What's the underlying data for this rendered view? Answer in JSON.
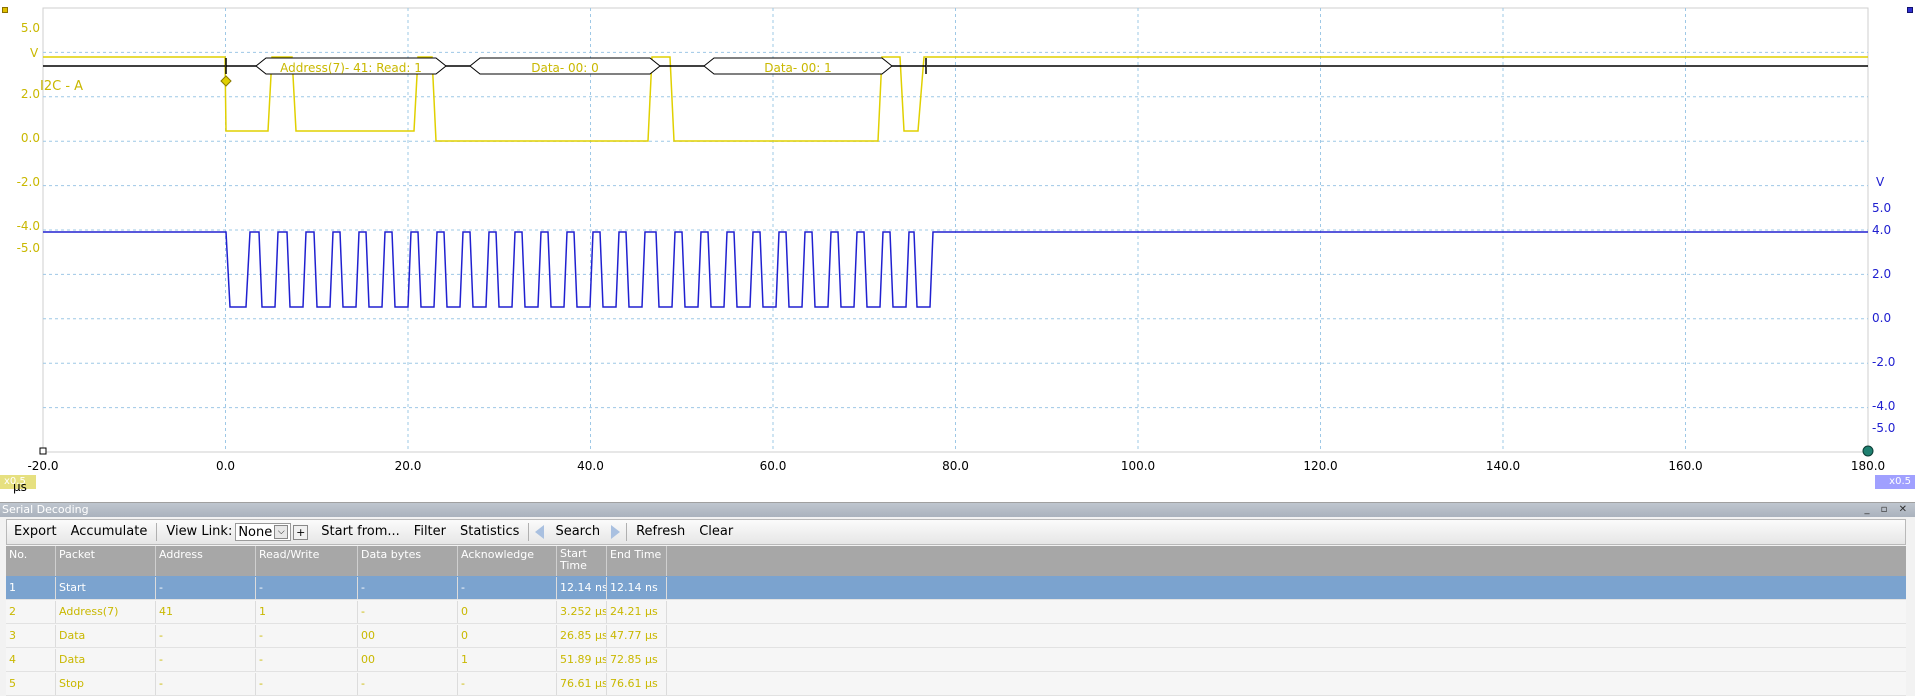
{
  "scope": {
    "channel_a": {
      "name": "I2C - A",
      "unit": "V",
      "color": "#e0d000",
      "ticks": [
        "5.0",
        "2.0",
        "0.0",
        "-2.0",
        "-4.0",
        "-5.0"
      ],
      "scale": "x0.5"
    },
    "channel_b": {
      "unit": "V",
      "color": "#2020d0",
      "ticks": [
        "5.0",
        "4.0",
        "2.0",
        "0.0",
        "-2.0",
        "-4.0",
        "-5.0"
      ],
      "scale": "x0.5"
    },
    "time_ticks": [
      "-20.0",
      "0.0",
      "20.0",
      "40.0",
      "60.0",
      "80.0",
      "100.0",
      "120.0",
      "140.0",
      "160.0",
      "180.0"
    ],
    "time_unit": "μs",
    "decode_labels": [
      "Address(7)- 41: Read: 1",
      "Data- 00: 0",
      "Data- 00: 1"
    ]
  },
  "panel": {
    "title": "Serial Decoding",
    "window_buttons": "_ ▫ ✕"
  },
  "toolbar": {
    "export": "Export",
    "accumulate": "Accumulate",
    "view_link_label": "View Link:",
    "view_link_value": "None",
    "add": "+",
    "start_from": "Start from...",
    "filter": "Filter",
    "statistics": "Statistics",
    "search": "Search",
    "refresh": "Refresh",
    "clear": "Clear"
  },
  "table": {
    "headers": [
      "No.",
      "Packet",
      "Address",
      "Read/Write",
      "Data bytes",
      "Acknowledge",
      "Start Time",
      "End Time"
    ],
    "rows": [
      [
        "1",
        "Start",
        "-",
        "-",
        "-",
        "-",
        "12.14 ns",
        "12.14 ns"
      ],
      [
        "2",
        "Address(7)",
        "41",
        "1",
        "-",
        "0",
        "3.252 μs",
        "24.21 μs"
      ],
      [
        "3",
        "Data",
        "-",
        "-",
        "00",
        "0",
        "26.85 μs",
        "47.77 μs"
      ],
      [
        "4",
        "Data",
        "-",
        "-",
        "00",
        "1",
        "51.89 μs",
        "72.85 μs"
      ],
      [
        "5",
        "Stop",
        "-",
        "-",
        "-",
        "-",
        "76.61 μs",
        "76.61 μs"
      ]
    ]
  }
}
